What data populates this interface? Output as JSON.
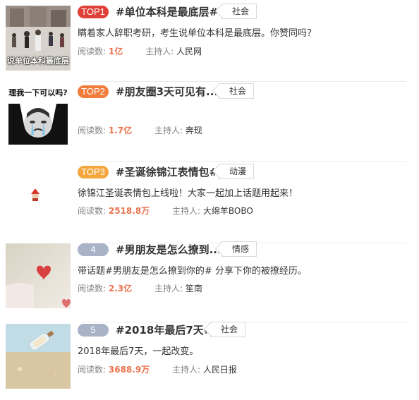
{
  "items": [
    {
      "rank": "TOP1",
      "rank_color": "#e0403a",
      "title": "#单位本科是最底层#",
      "tag": "社会",
      "desc": "瞒着家人辞职考研，考生说单位本科是最底层。你赞同吗？",
      "reads_label": "阅读数:",
      "reads": "1亿",
      "host_label": "主持人:",
      "host": "人民网",
      "thumb_caption": "说单位本科最底层",
      "thumb_icon": "street-photo"
    },
    {
      "rank": "TOP2",
      "rank_color": "#f07d3c",
      "title": "#朋友圈3天可见有...",
      "tag": "社会",
      "desc": "",
      "reads_label": "阅读数:",
      "reads": "1.7亿",
      "host_label": "主持人:",
      "host": "奔现",
      "thumb_caption": "理我一下可以吗?",
      "thumb_icon": "meme-face"
    },
    {
      "rank": "TOP3",
      "rank_color": "#f4a63d",
      "title": "#圣诞徐锦江表情包#",
      "tag": "动漫",
      "desc": "徐锦江圣诞表情包上线啦！大家一起加上话题用起来！",
      "reads_label": "阅读数:",
      "reads": "2518.8万",
      "host_label": "主持人:",
      "host": "大绵羊BOBO",
      "thumb_icon": "small-sticker"
    },
    {
      "rank": "4",
      "rank_color": "#a9b3c7",
      "title": "#男朋友是怎么撩到...",
      "tag": "情感",
      "desc": "带话题#男朋友是怎么撩到你的# 分享下你的被撩经历。",
      "reads_label": "阅读数:",
      "reads": "2.3亿",
      "host_label": "主持人:",
      "host": "笙南",
      "thumb_icon": "heart-photo"
    },
    {
      "rank": "5",
      "rank_color": "#a9b3c7",
      "title": "#2018年最后7天#",
      "tag": "社会",
      "desc": "2018年最后7天，一起改变。",
      "reads_label": "阅读数:",
      "reads": "3688.9万",
      "host_label": "主持人:",
      "host": "人民日报",
      "thumb_icon": "bottle-photo"
    }
  ]
}
